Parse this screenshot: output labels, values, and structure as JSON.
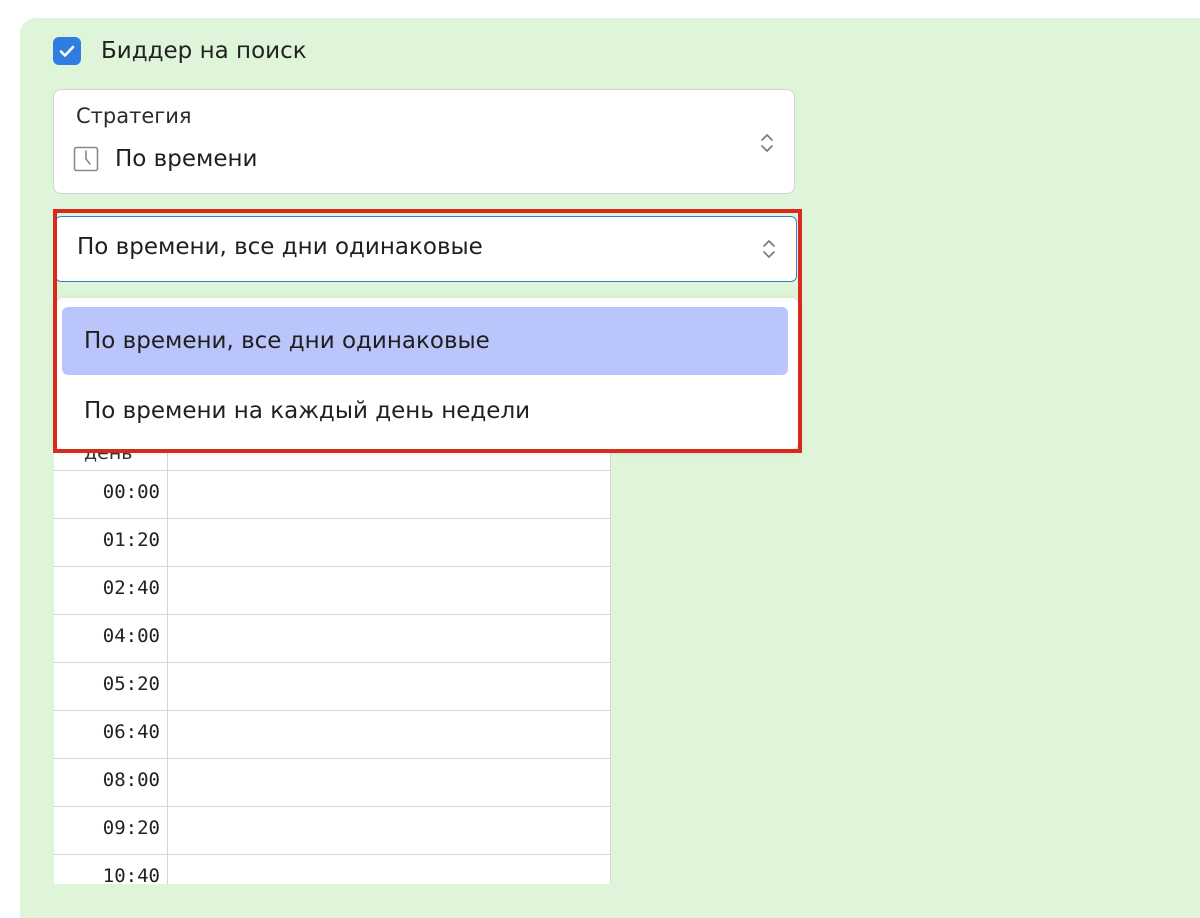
{
  "bidder": {
    "checkbox_label": "Биддер на поиск",
    "checked": true,
    "accent_color": "#2f7de1"
  },
  "strategy": {
    "caption": "Стратегия",
    "value": "По времени",
    "value_icon": "clock-icon"
  },
  "schedule_select": {
    "value": "По времени, все дни одинаковые",
    "options": [
      {
        "label": "По времени, все дни одинаковые",
        "selected": true
      },
      {
        "label": "По времени на каждый день недели",
        "selected": false
      }
    ]
  },
  "table": {
    "header_day": "день",
    "times": [
      "00:00",
      "01:20",
      "02:40",
      "04:00",
      "05:20",
      "06:40",
      "08:00",
      "09:20",
      "10:40"
    ]
  },
  "colors": {
    "panel_bg": "#dff5d9",
    "highlight_frame": "#d9291c",
    "selected_option_bg": "#b9c5fb"
  }
}
